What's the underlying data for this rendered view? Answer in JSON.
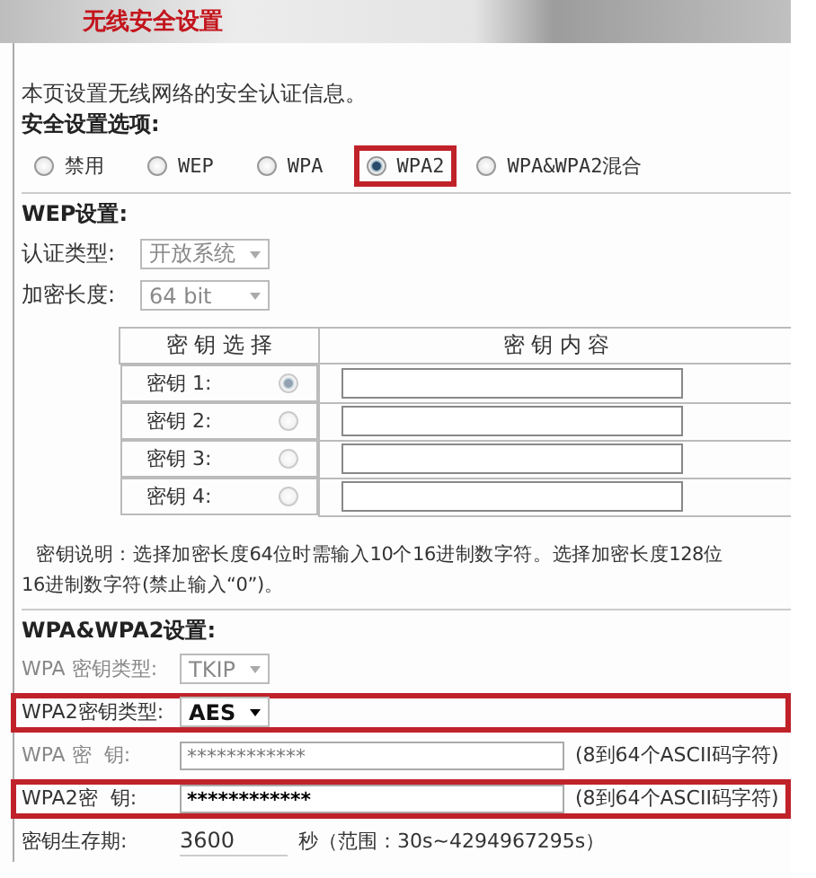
{
  "header": {
    "title": "无线安全设置"
  },
  "intro": "本页设置无线网络的安全认证信息。",
  "security": {
    "label": "安全设置选项:",
    "options": [
      {
        "label": "禁用",
        "selected": false,
        "highlighted": false
      },
      {
        "label": "WEP",
        "selected": false,
        "highlighted": false
      },
      {
        "label": "WPA",
        "selected": false,
        "highlighted": false
      },
      {
        "label": "WPA2",
        "selected": true,
        "highlighted": true
      },
      {
        "label": "WPA&WPA2混合",
        "selected": false,
        "highlighted": false
      }
    ]
  },
  "wep": {
    "heading": "WEP设置:",
    "fields": [
      {
        "label": "认证类型:",
        "value": "开放系统",
        "disabled": true
      },
      {
        "label": "加密长度:",
        "value": "64 bit",
        "disabled": true
      }
    ],
    "key_table": {
      "columns": [
        "密 钥 选 择",
        "密 钥 内 容"
      ],
      "rows": [
        {
          "label": "密钥 1:",
          "selected": true,
          "disabled": true
        },
        {
          "label": "密钥 2:",
          "selected": false,
          "disabled": true
        },
        {
          "label": "密钥 3:",
          "selected": false,
          "disabled": true
        },
        {
          "label": "密钥 4:",
          "selected": false,
          "disabled": true
        }
      ]
    },
    "note_lines": [
      "密钥说明：选择加密长度64位时需输入10个16进制数字符。选择加密长度128位",
      "16进制数字符(禁止输入“0”)。"
    ]
  },
  "wpa": {
    "heading": "WPA&WPA2设置:",
    "fields": [
      {
        "kind": "select",
        "label": "WPA 密钥类型:",
        "value": "TKIP",
        "disabled": true,
        "highlighted": false
      },
      {
        "kind": "select",
        "label": "WPA2密钥类型:",
        "value": "AES",
        "disabled": false,
        "highlighted": true
      },
      {
        "kind": "password",
        "label": "WPA 密  钥:",
        "value": "************",
        "hint": "(8到64个ASCII码字符)",
        "disabled": true,
        "highlighted": false
      },
      {
        "kind": "password",
        "label": "WPA2密  钥:",
        "value": "************",
        "hint": "(8到64个ASCII码字符)",
        "disabled": false,
        "highlighted": true
      },
      {
        "kind": "text",
        "label": "密钥生存期:",
        "value": "3600",
        "hint": "秒（范围：30s~4294967295s）",
        "disabled": false,
        "highlighted": false
      }
    ]
  }
}
